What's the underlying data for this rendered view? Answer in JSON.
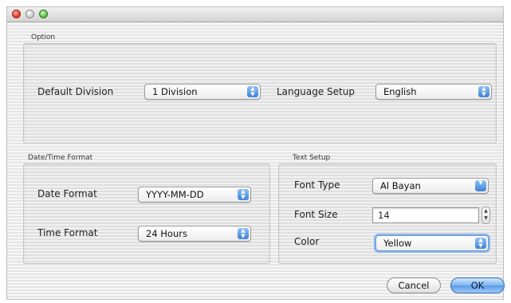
{
  "window": {
    "traffic_lights": {
      "close_icon": "close-icon",
      "minimize_icon": "minimize-icon",
      "zoom_icon": "zoom-icon"
    }
  },
  "option": {
    "title": "Option",
    "default_division_label": "Default Division",
    "default_division_value": "1 Division",
    "language_label": "Language Setup",
    "language_value": "English"
  },
  "datetime": {
    "title": "Date/Time Format",
    "date_label": "Date Format",
    "date_value": "YYYY-MM-DD",
    "time_label": "Time Format",
    "time_value": "24 Hours"
  },
  "text": {
    "title": "Text Setup",
    "font_type_label": "Font Type",
    "font_type_value": "Al Bayan",
    "font_size_label": "Font Size",
    "font_size_value": "14",
    "color_label": "Color",
    "color_value": "Yellow"
  },
  "buttons": {
    "cancel": "Cancel",
    "ok": "OK"
  },
  "colors": {
    "accent": "#5c9be6",
    "close": "#e23b2c",
    "zoom": "#61c04a"
  }
}
